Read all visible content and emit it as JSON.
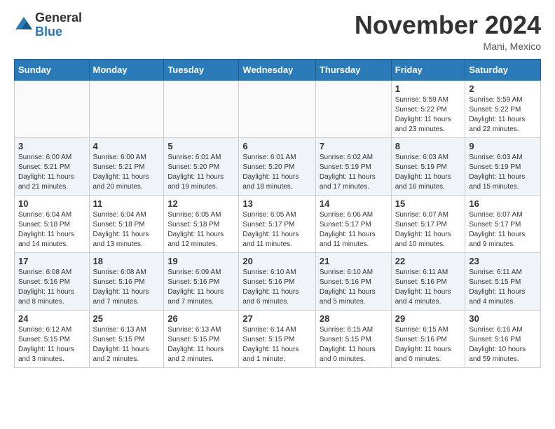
{
  "header": {
    "logo_general": "General",
    "logo_blue": "Blue",
    "month_title": "November 2024",
    "location": "Mani, Mexico"
  },
  "weekdays": [
    "Sunday",
    "Monday",
    "Tuesday",
    "Wednesday",
    "Thursday",
    "Friday",
    "Saturday"
  ],
  "weeks": [
    [
      {
        "day": "",
        "info": ""
      },
      {
        "day": "",
        "info": ""
      },
      {
        "day": "",
        "info": ""
      },
      {
        "day": "",
        "info": ""
      },
      {
        "day": "",
        "info": ""
      },
      {
        "day": "1",
        "info": "Sunrise: 5:59 AM\nSunset: 5:22 PM\nDaylight: 11 hours\nand 23 minutes."
      },
      {
        "day": "2",
        "info": "Sunrise: 5:59 AM\nSunset: 5:22 PM\nDaylight: 11 hours\nand 22 minutes."
      }
    ],
    [
      {
        "day": "3",
        "info": "Sunrise: 6:00 AM\nSunset: 5:21 PM\nDaylight: 11 hours\nand 21 minutes."
      },
      {
        "day": "4",
        "info": "Sunrise: 6:00 AM\nSunset: 5:21 PM\nDaylight: 11 hours\nand 20 minutes."
      },
      {
        "day": "5",
        "info": "Sunrise: 6:01 AM\nSunset: 5:20 PM\nDaylight: 11 hours\nand 19 minutes."
      },
      {
        "day": "6",
        "info": "Sunrise: 6:01 AM\nSunset: 5:20 PM\nDaylight: 11 hours\nand 18 minutes."
      },
      {
        "day": "7",
        "info": "Sunrise: 6:02 AM\nSunset: 5:19 PM\nDaylight: 11 hours\nand 17 minutes."
      },
      {
        "day": "8",
        "info": "Sunrise: 6:03 AM\nSunset: 5:19 PM\nDaylight: 11 hours\nand 16 minutes."
      },
      {
        "day": "9",
        "info": "Sunrise: 6:03 AM\nSunset: 5:19 PM\nDaylight: 11 hours\nand 15 minutes."
      }
    ],
    [
      {
        "day": "10",
        "info": "Sunrise: 6:04 AM\nSunset: 5:18 PM\nDaylight: 11 hours\nand 14 minutes."
      },
      {
        "day": "11",
        "info": "Sunrise: 6:04 AM\nSunset: 5:18 PM\nDaylight: 11 hours\nand 13 minutes."
      },
      {
        "day": "12",
        "info": "Sunrise: 6:05 AM\nSunset: 5:18 PM\nDaylight: 11 hours\nand 12 minutes."
      },
      {
        "day": "13",
        "info": "Sunrise: 6:05 AM\nSunset: 5:17 PM\nDaylight: 11 hours\nand 11 minutes."
      },
      {
        "day": "14",
        "info": "Sunrise: 6:06 AM\nSunset: 5:17 PM\nDaylight: 11 hours\nand 11 minutes."
      },
      {
        "day": "15",
        "info": "Sunrise: 6:07 AM\nSunset: 5:17 PM\nDaylight: 11 hours\nand 10 minutes."
      },
      {
        "day": "16",
        "info": "Sunrise: 6:07 AM\nSunset: 5:17 PM\nDaylight: 11 hours\nand 9 minutes."
      }
    ],
    [
      {
        "day": "17",
        "info": "Sunrise: 6:08 AM\nSunset: 5:16 PM\nDaylight: 11 hours\nand 8 minutes."
      },
      {
        "day": "18",
        "info": "Sunrise: 6:08 AM\nSunset: 5:16 PM\nDaylight: 11 hours\nand 7 minutes."
      },
      {
        "day": "19",
        "info": "Sunrise: 6:09 AM\nSunset: 5:16 PM\nDaylight: 11 hours\nand 7 minutes."
      },
      {
        "day": "20",
        "info": "Sunrise: 6:10 AM\nSunset: 5:16 PM\nDaylight: 11 hours\nand 6 minutes."
      },
      {
        "day": "21",
        "info": "Sunrise: 6:10 AM\nSunset: 5:16 PM\nDaylight: 11 hours\nand 5 minutes."
      },
      {
        "day": "22",
        "info": "Sunrise: 6:11 AM\nSunset: 5:16 PM\nDaylight: 11 hours\nand 4 minutes."
      },
      {
        "day": "23",
        "info": "Sunrise: 6:11 AM\nSunset: 5:15 PM\nDaylight: 11 hours\nand 4 minutes."
      }
    ],
    [
      {
        "day": "24",
        "info": "Sunrise: 6:12 AM\nSunset: 5:15 PM\nDaylight: 11 hours\nand 3 minutes."
      },
      {
        "day": "25",
        "info": "Sunrise: 6:13 AM\nSunset: 5:15 PM\nDaylight: 11 hours\nand 2 minutes."
      },
      {
        "day": "26",
        "info": "Sunrise: 6:13 AM\nSunset: 5:15 PM\nDaylight: 11 hours\nand 2 minutes."
      },
      {
        "day": "27",
        "info": "Sunrise: 6:14 AM\nSunset: 5:15 PM\nDaylight: 11 hours\nand 1 minute."
      },
      {
        "day": "28",
        "info": "Sunrise: 6:15 AM\nSunset: 5:15 PM\nDaylight: 11 hours\nand 0 minutes."
      },
      {
        "day": "29",
        "info": "Sunrise: 6:15 AM\nSunset: 5:16 PM\nDaylight: 11 hours\nand 0 minutes."
      },
      {
        "day": "30",
        "info": "Sunrise: 6:16 AM\nSunset: 5:16 PM\nDaylight: 10 hours\nand 59 minutes."
      }
    ]
  ]
}
